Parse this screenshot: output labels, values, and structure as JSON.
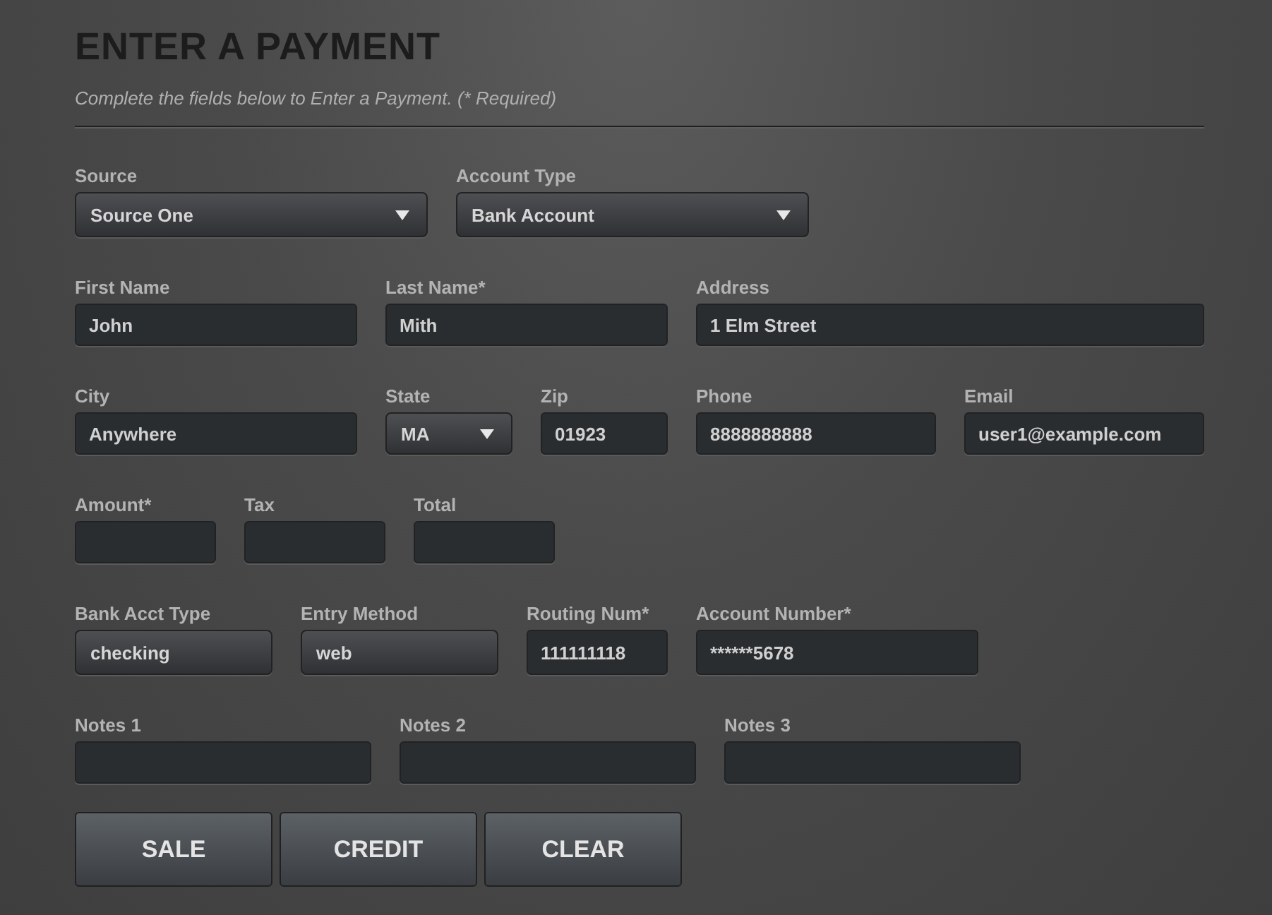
{
  "title": "ENTER A PAYMENT",
  "subtitle": "Complete the fields below to Enter a Payment. (* Required)",
  "rows": [
    [
      {
        "label": "Source",
        "kind": "select",
        "value": "Source One"
      },
      {
        "label": "Account Type",
        "kind": "select",
        "value": "Bank Account"
      }
    ],
    [
      {
        "label": "First Name",
        "kind": "text",
        "value": "John"
      },
      {
        "label": "Last Name*",
        "kind": "text",
        "value": "Mith"
      },
      {
        "label": "Address",
        "kind": "text",
        "value": "1 Elm Street"
      }
    ],
    [
      {
        "label": "City",
        "kind": "text",
        "value": "Anywhere"
      },
      {
        "label": "State",
        "kind": "select",
        "value": "MA"
      },
      {
        "label": "Zip",
        "kind": "text",
        "value": "01923"
      },
      {
        "label": "Phone",
        "kind": "text",
        "value": "8888888888"
      },
      {
        "label": "Email",
        "kind": "text",
        "value": "user1@example.com"
      }
    ],
    [
      {
        "label": "Amount*",
        "kind": "text"
      },
      {
        "label": "Tax",
        "kind": "text"
      },
      {
        "label": "Total",
        "kind": "text"
      }
    ],
    [
      {
        "label": "Bank Acct Type",
        "kind": "readonly",
        "value": "checking"
      },
      {
        "label": "Entry Method",
        "kind": "readonly",
        "value": "web"
      },
      {
        "label": "Routing Num*",
        "kind": "text",
        "value": "111111118"
      },
      {
        "label": "Account Number*",
        "kind": "text",
        "value": "******5678"
      }
    ],
    [
      {
        "label": "Notes 1",
        "kind": "text"
      },
      {
        "label": "Notes 2",
        "kind": "text"
      },
      {
        "label": "Notes 3",
        "kind": "text"
      }
    ]
  ],
  "buttons": [
    "SALE",
    "CREDIT",
    "CLEAR"
  ]
}
